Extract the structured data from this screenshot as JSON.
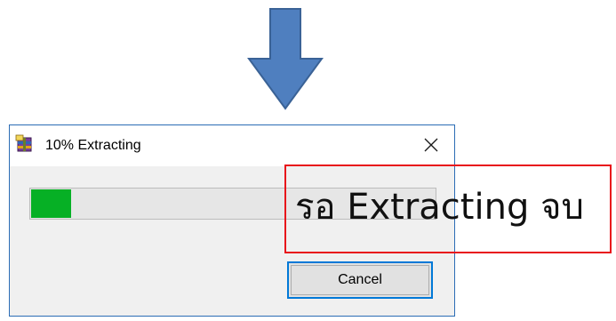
{
  "arrow": {
    "icon": "down-arrow-icon",
    "color": "#4f7fbf",
    "outline": "#3a6296"
  },
  "dialog": {
    "title": "10% Extracting",
    "app_icon": "winrar-icon",
    "close_icon": "close-icon",
    "progress": 0.1,
    "progress_color": "#06b025",
    "cancel_label": "Cancel",
    "accent": "#0078d7"
  },
  "annotation": {
    "text": "รอ Extracting จบ",
    "border_color": "#e8131b"
  }
}
